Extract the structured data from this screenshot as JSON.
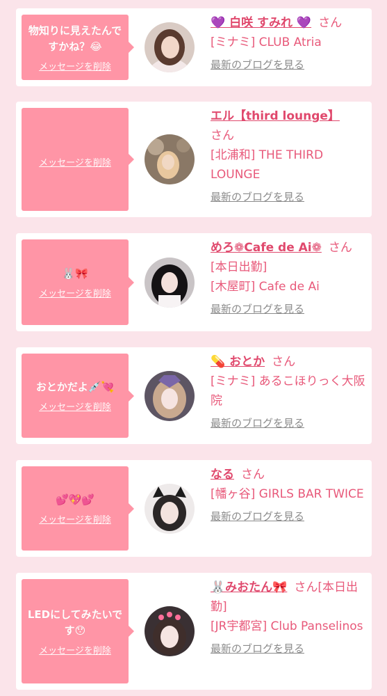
{
  "colors": {
    "background": "#fbe4ea",
    "bubble": "#ff95a6",
    "accent": "#e8597a",
    "link_gray": "#8b8b8b"
  },
  "entries": [
    {
      "message": "物知りに見えたんですかね？😂",
      "delete_label": "メッセージを削除",
      "name": "💜 白咲 すみれ 💜",
      "san": "さん",
      "status": "",
      "shop": "[ミナミ] CLUB Atria",
      "blog_label": "最新のブログを見る"
    },
    {
      "message": "",
      "delete_label": "メッセージを削除",
      "name": "エル【third lounge】",
      "san": "さん",
      "status": "",
      "shop": "[北浦和] THE THIRD LOUNGE",
      "blog_label": "最新のブログを見る"
    },
    {
      "message": "🐰🎀",
      "delete_label": "メッセージを削除",
      "name": "めろ❁Cafe de Ai❁",
      "san": "さん",
      "status": "[本日出勤]",
      "shop": "[木屋町] Cafe de Ai",
      "blog_label": "最新のブログを見る"
    },
    {
      "message": "おとかだよ💉💘",
      "delete_label": "メッセージを削除",
      "name": "💊 おとか",
      "san": "さん",
      "status": "",
      "shop": "[ミナミ] あるこほりっく大阪院",
      "blog_label": "最新のブログを見る"
    },
    {
      "message": "💕💖💕",
      "delete_label": "メッセージを削除",
      "name": "なる",
      "san": "さん",
      "status": "",
      "shop": "[幡ヶ谷] GIRLS BAR TWICE",
      "blog_label": "最新のブログを見る"
    },
    {
      "message": "LEDにしてみたいです😯",
      "delete_label": "メッセージを削除",
      "name": "🐰みおたん🎀",
      "san": "さん",
      "status": "[本日出勤]",
      "shop": "[JR宇都宮] Club Panselinos",
      "blog_label": "最新のブログを見る"
    }
  ]
}
